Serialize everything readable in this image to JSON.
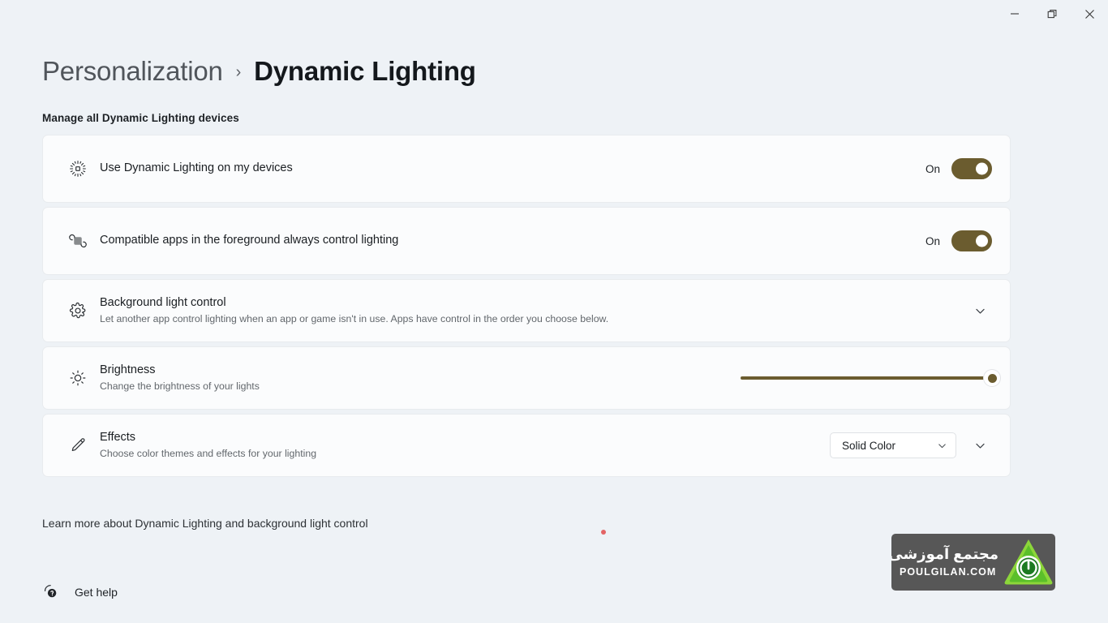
{
  "window": {
    "controls": [
      {
        "name": "minimize",
        "glyph": "minimize-icon"
      },
      {
        "name": "restore",
        "glyph": "restore-icon"
      },
      {
        "name": "close",
        "glyph": "close-icon"
      }
    ]
  },
  "breadcrumb": {
    "parent": "Personalization",
    "separator": "›",
    "current": "Dynamic Lighting"
  },
  "section": {
    "title": "Manage all Dynamic Lighting devices"
  },
  "accent_color": "#6b5c2f",
  "page_background": "#eef2f6",
  "card_background": "#fbfcfd",
  "settings": [
    {
      "icon": "dynamic-lighting-icon",
      "title": "Use Dynamic Lighting on my devices",
      "subtitle": "",
      "control": "toggle",
      "state_label": "On",
      "state": true
    },
    {
      "icon": "compatible-apps-icon",
      "title": "Compatible apps in the foreground always control lighting",
      "subtitle": "",
      "control": "toggle",
      "state_label": "On",
      "state": true
    },
    {
      "icon": "gear-icon",
      "title": "Background light control",
      "subtitle": "Let another app control lighting when an app or game isn't in use. Apps have control in the order you choose below.",
      "control": "expander"
    },
    {
      "icon": "brightness-icon",
      "title": "Brightness",
      "subtitle": "Change the brightness of your lights",
      "control": "slider",
      "slider_value": 100,
      "slider_min": 0,
      "slider_max": 100
    },
    {
      "icon": "pencil-icon",
      "title": "Effects",
      "subtitle": "Choose color themes and effects for your lighting",
      "control": "dropdown",
      "dropdown_value": "Solid Color",
      "dropdown_options": [
        "Solid Color"
      ]
    }
  ],
  "footer": {
    "learn_more": "Learn more about Dynamic Lighting and background light control",
    "get_help": "Get help"
  },
  "watermark": {
    "persian": "مجتمع آموزشی پل",
    "english": "POULGILAN.COM",
    "logo_color": "#6ec82a",
    "badge_color": "#575757"
  }
}
